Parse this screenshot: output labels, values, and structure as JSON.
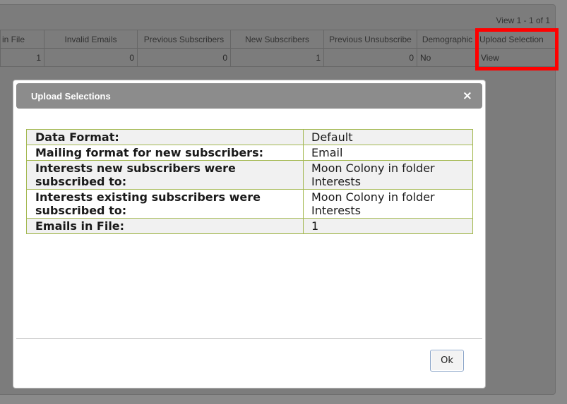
{
  "pager": {
    "text": "View 1 - 1 of 1"
  },
  "grid": {
    "columns": [
      "in File",
      "Invalid Emails",
      "Previous Subscribers",
      "New Subscribers",
      "Previous Unsubscribe",
      "Demographic",
      "Upload Selection"
    ],
    "row": [
      "1",
      "0",
      "0",
      "1",
      "0",
      "No",
      "View"
    ]
  },
  "modal": {
    "title": "Upload Selections",
    "rows": [
      {
        "label": "Data Format:",
        "value": "Default"
      },
      {
        "label": "Mailing format for new subscribers:",
        "value": "Email"
      },
      {
        "label": "Interests new subscribers were subscribed to:",
        "value": "Moon Colony in folder Interests"
      },
      {
        "label": "Interests existing subscribers were subscribed to:",
        "value": "Moon Colony in folder Interests"
      },
      {
        "label": "Emails in File:",
        "value": "1"
      }
    ],
    "ok_label": "Ok",
    "close_glyph": "×"
  },
  "colors": {
    "highlight": "#ff0000",
    "table_border": "#a3b84f",
    "header_bg": "#8c8c8c"
  }
}
